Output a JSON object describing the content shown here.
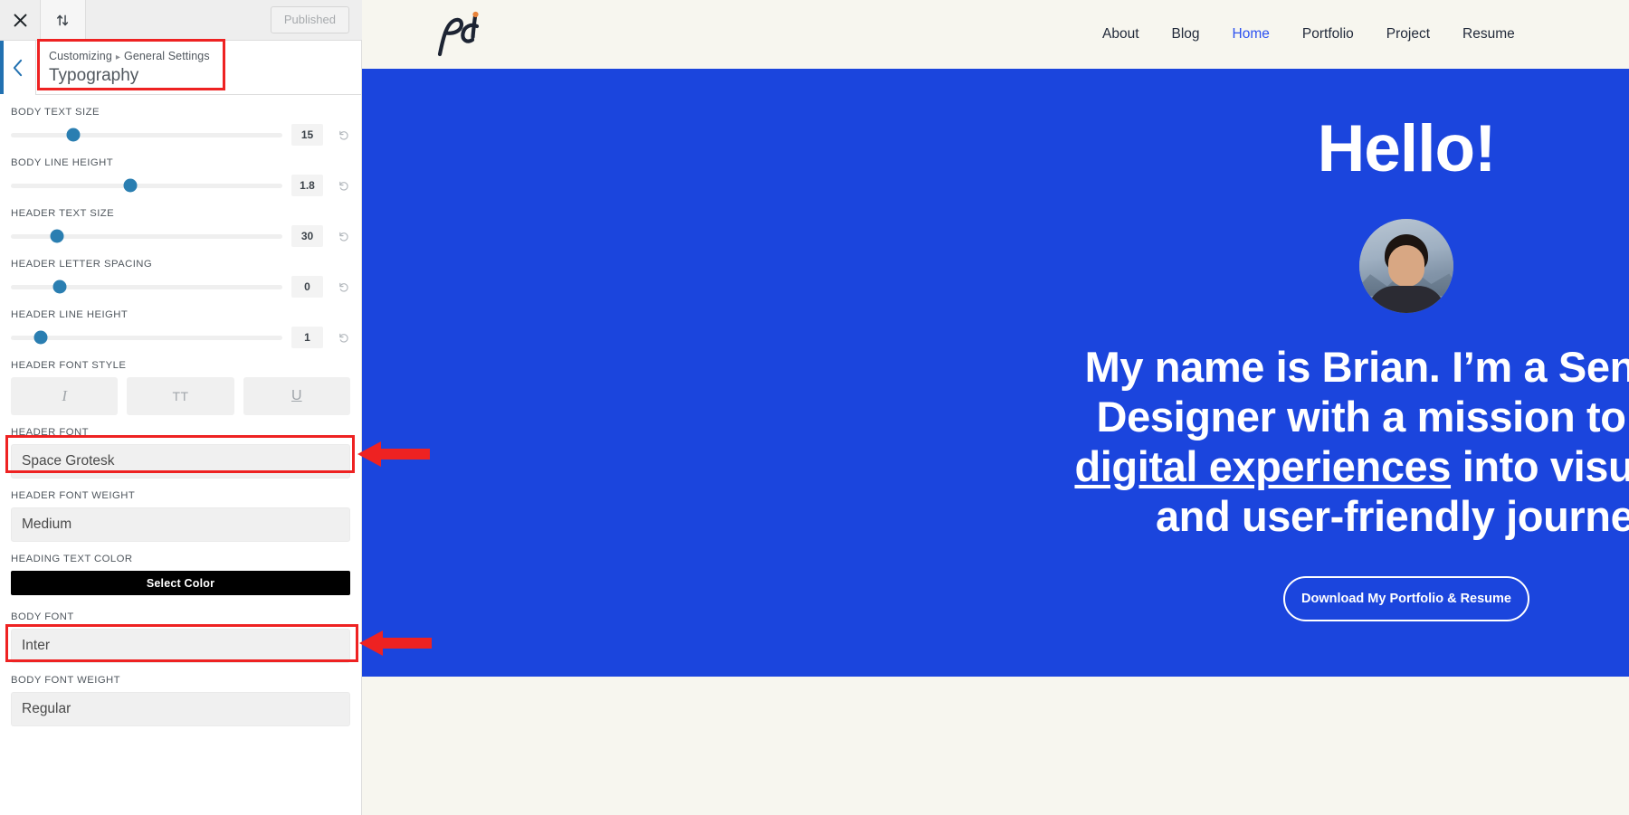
{
  "customizer": {
    "topbar": {
      "close_icon": "close-x-icon",
      "devices_icon": "device-preview-icon",
      "publish_label": "Published"
    },
    "header": {
      "back_icon": "chevron-left-icon",
      "breadcrumb_root": "Customizing",
      "breadcrumb_sep": "▸",
      "breadcrumb_parent": "General Settings",
      "title": "Typography"
    },
    "sliders": [
      {
        "label": "BODY TEXT SIZE",
        "value": "15",
        "pct": 23
      },
      {
        "label": "BODY LINE HEIGHT",
        "value": "1.8",
        "pct": 44
      },
      {
        "label": "HEADER TEXT SIZE",
        "value": "30",
        "pct": 17
      },
      {
        "label": "HEADER LETTER SPACING",
        "value": "0",
        "pct": 18
      },
      {
        "label": "HEADER LINE HEIGHT",
        "value": "1",
        "pct": 11
      }
    ],
    "font_style": {
      "label": "HEADER FONT STYLE",
      "buttons": [
        {
          "name": "italic-toggle",
          "glyph": "I"
        },
        {
          "name": "uppercase-toggle",
          "glyph": "TT"
        },
        {
          "name": "underline-toggle",
          "glyph": "U"
        }
      ]
    },
    "header_font": {
      "label": "HEADER FONT",
      "value": "Space Grotesk"
    },
    "header_font_weight": {
      "label": "HEADER FONT WEIGHT",
      "value": "Medium"
    },
    "heading_text_color": {
      "label": "HEADING TEXT COLOR",
      "button_label": "Select Color",
      "swatch": "#000000"
    },
    "body_font": {
      "label": "BODY FONT",
      "value": "Inter"
    },
    "body_font_weight": {
      "label": "BODY FONT WEIGHT",
      "value": "Regular"
    },
    "annotation_color": "#ee2222"
  },
  "preview": {
    "logo": {
      "name": "pdc-monogram-logo",
      "mark": "pdc",
      "dot_color": "#e8833a",
      "ink": "#1d2433"
    },
    "nav": [
      {
        "label": "About",
        "active": false
      },
      {
        "label": "Blog",
        "active": false
      },
      {
        "label": "Home",
        "active": true
      },
      {
        "label": "Portfolio",
        "active": false
      },
      {
        "label": "Project",
        "active": false
      },
      {
        "label": "Resume",
        "active": false
      }
    ],
    "hero": {
      "background": "#1b45dd",
      "greeting": "Hello!",
      "avatar_alt": "portrait-photo",
      "paragraph_line1": "My name is Brian. I’m a Senior P",
      "paragraph_line2": "Designer with a mission to tran",
      "paragraph_line3_link": "digital experiences",
      "paragraph_line3_rest": " into visually s",
      "paragraph_line4": "and user-friendly journey",
      "cta_label": "Download My Portfolio & Resume"
    },
    "nav_background": "#f7f6ef"
  }
}
